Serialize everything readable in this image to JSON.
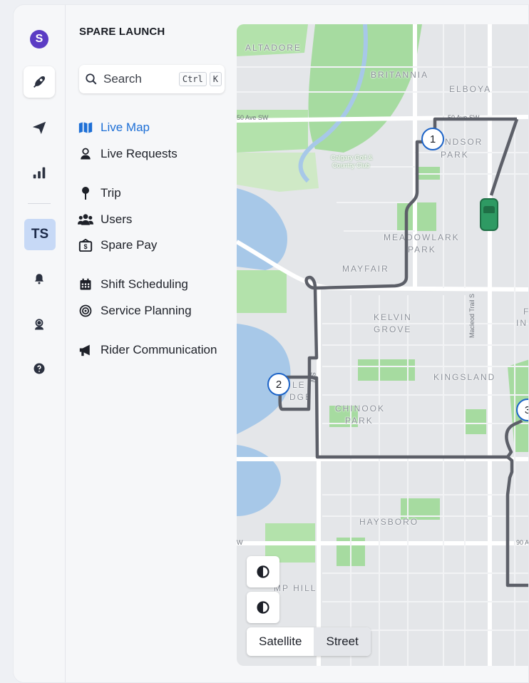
{
  "app": {
    "logo_letter": "S",
    "title": "SPARE LAUNCH"
  },
  "rail": {
    "items": [
      {
        "icon": "rocket-icon",
        "active": true
      },
      {
        "icon": "paper-plane-icon"
      },
      {
        "icon": "bar-chart-icon"
      },
      {
        "icon": "bell-icon"
      },
      {
        "icon": "headset-agent-icon"
      },
      {
        "icon": "help-circle-icon"
      }
    ],
    "user_initials": "TS"
  },
  "search": {
    "label": "Search",
    "shortcut_ctrl": "Ctrl",
    "shortcut_key": "K"
  },
  "nav": {
    "live_map": "Live Map",
    "live_requests": "Live Requests",
    "trip": "Trip",
    "users": "Users",
    "spare_pay": "Spare Pay",
    "shift_scheduling": "Shift Scheduling",
    "service_planning": "Service Planning",
    "rider_communication": "Rider Communication"
  },
  "map": {
    "neighborhoods": {
      "altadore": "ALTADORE",
      "britannia": "BRITANNIA",
      "elboya": "ELBOYA",
      "windsor_1": "NDSOR",
      "windsor_2": "PARK",
      "golf": "Calgary Golf &",
      "golf2": "Country Club",
      "meadowlark_1": "MEADOWLARK",
      "meadowlark_2": "PARK",
      "mayfair": "MAYFAIR",
      "kelvin_1": "KELVIN",
      "kelvin_2": "GROVE",
      "kingsland": "KINGSLAND",
      "chinook_1": "CHINOOK",
      "chinook_2": "PARK",
      "eagle_1": "LE",
      "eagle_2": "DGE",
      "haysboro": "HAYSBORO",
      "pump_hill": "MP HILL",
      "fairview_1": "F",
      "fairview_2": "IN"
    },
    "streets": {
      "ave50": "50 Ave SW",
      "ave50b": "50 Ave SW",
      "macleod": "Macleod Trail S",
      "ave90": "90 A",
      "sw": "SW",
      "w": "W"
    },
    "stops": [
      "1",
      "2",
      "3"
    ],
    "route_color": "#5c5f68",
    "vehicle_color": "#2e9a63",
    "view_options": {
      "satellite": "Satellite",
      "street": "Street",
      "selected": "Street"
    }
  },
  "colors": {
    "accent": "#1d6fd6",
    "brand": "#5b3cc4",
    "park": "#a6dba0",
    "water": "#a7c8e8"
  }
}
